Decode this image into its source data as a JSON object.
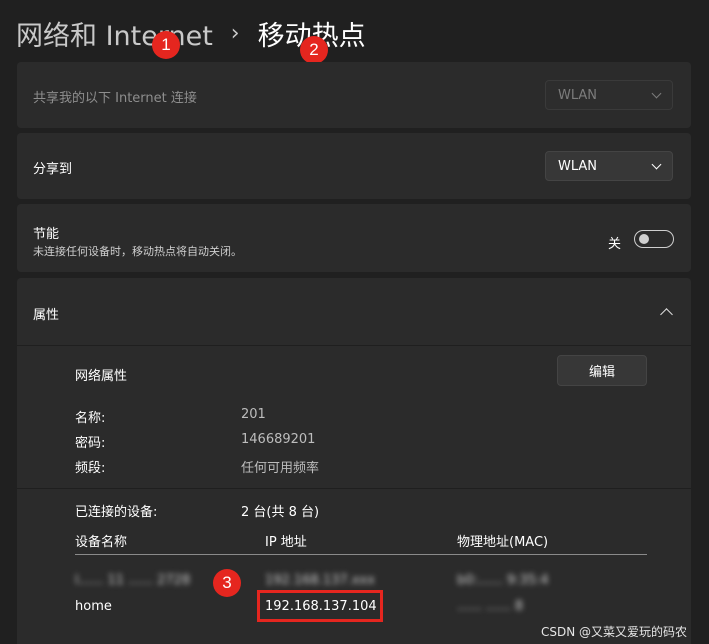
{
  "breadcrumb": {
    "parent": "网络和 Internet",
    "separator": "›",
    "current": "移动热点"
  },
  "markers": [
    "1",
    "2",
    "3"
  ],
  "share_source": {
    "label": "共享我的以下 Internet 连接",
    "value": "WLAN"
  },
  "share_to": {
    "label": "分享到",
    "value": "WLAN"
  },
  "power_saving": {
    "title": "节能",
    "description": "未连接任何设备时，移动热点将自动关闭。",
    "state_label": "关",
    "enabled": false
  },
  "properties": {
    "header": "属性",
    "network_props_title": "网络属性",
    "edit_label": "编辑",
    "fields": [
      {
        "label": "名称:",
        "value": "201"
      },
      {
        "label": "密码:",
        "value": "146689201"
      },
      {
        "label": "频段:",
        "value": "任何可用频率"
      }
    ],
    "connected_label": "已连接的设备:",
    "connected_value": "2 台(共 8 台)",
    "columns": [
      "设备名称",
      "IP 地址",
      "物理地址(MAC)"
    ],
    "devices": [
      {
        "name": "l...... 11 ...... 2728",
        "ip": "192.168.137.xxx",
        "mac": "b0:...... 9:35:4"
      },
      {
        "name": "home",
        "ip": "192.168.137.104",
        "mac": "...... ...... 8"
      }
    ]
  },
  "watermark": "CSDN @又菜又爱玩的码农",
  "colors": {
    "background": "#202020",
    "card": "#2b2b2b",
    "annotation_red": "#e5261f"
  }
}
